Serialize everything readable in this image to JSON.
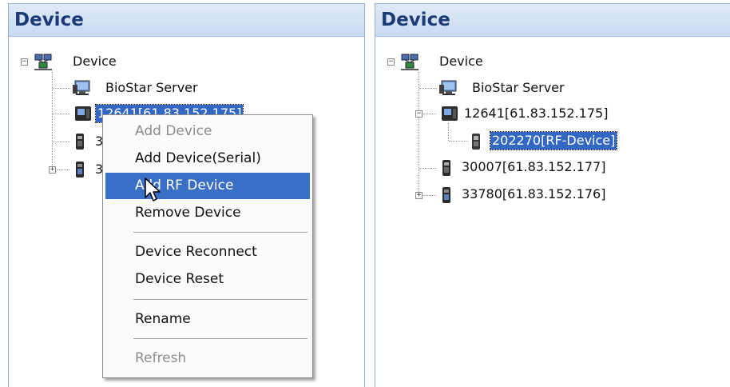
{
  "left_panel": {
    "title": "Device",
    "tree": {
      "root": "Device",
      "server": "BioStar Server",
      "selected_device": "12641[61.83.152.175]",
      "partial_3a": "3",
      "partial_3b": "3"
    }
  },
  "context_menu": {
    "items": [
      {
        "label": "Add Device",
        "state": "disabled"
      },
      {
        "label": "Add Device(Serial)",
        "state": "enabled"
      },
      {
        "label": "Add RF Device",
        "state": "hover"
      },
      {
        "label": "Remove Device",
        "state": "enabled"
      },
      {
        "label": "Device Reconnect",
        "state": "enabled"
      },
      {
        "label": "Device Reset",
        "state": "enabled"
      },
      {
        "label": "Rename",
        "state": "enabled"
      },
      {
        "label": "Refresh",
        "state": "disabled"
      }
    ]
  },
  "right_panel": {
    "title": "Device",
    "tree": {
      "root": "Device",
      "server": "BioStar Server",
      "device_1": "12641[61.83.152.175]",
      "rf_device": "202270[RF-Device]",
      "device_2": "30007[61.83.152.177]",
      "device_3": "33780[61.83.152.176]"
    }
  },
  "colors": {
    "header_text": "#1c3a78",
    "selection": "#3267c4",
    "menu_hover": "#3a6fc8",
    "disabled_text": "#8c8c8c"
  },
  "icons": [
    "network-icon",
    "server-icon",
    "device-icon",
    "rf-device-icon",
    "mouse-cursor-icon"
  ]
}
